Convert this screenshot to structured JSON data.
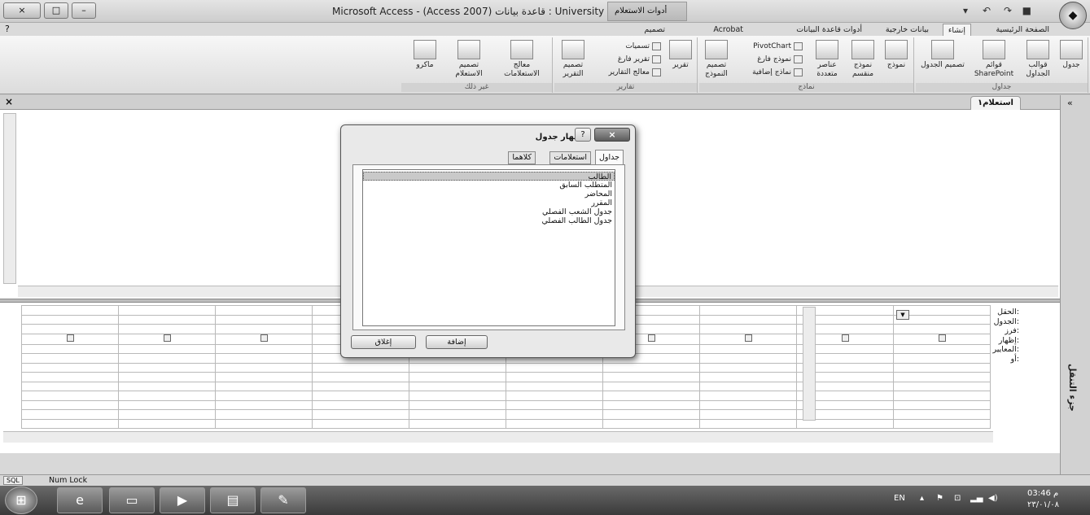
{
  "window": {
    "title": "Microsoft Access - (Access 2007) قاعدة بيانات : University",
    "contextual_tab": "أدوات الاستعلام",
    "controls": [
      "×",
      "□",
      "–"
    ]
  },
  "ribbon": {
    "tabs": [
      "الصفحة الرئيسية",
      "إنشاء",
      "بيانات خارجية",
      "أدوات قاعدة البيانات",
      "Acrobat",
      "تصميم"
    ],
    "active_tab": "إنشاء",
    "groups": {
      "tables": {
        "label": "جداول",
        "buttons": [
          "جدول",
          "قوالب الجداول",
          "قوائم SharePoint",
          "تصميم الجدول"
        ]
      },
      "forms": {
        "label": "نماذج",
        "buttons": [
          "نموذج",
          "نموذج منقسم",
          "عناصر متعددة",
          "تصميم النموذج"
        ],
        "small": [
          "PivotChart",
          "نموذج فارغ",
          "نماذج إضافية"
        ]
      },
      "reports": {
        "label": "تقارير",
        "buttons": [
          "تقرير",
          "تصميم التقرير"
        ],
        "small": [
          "تسميات",
          "تقرير فارغ",
          "معالج التقارير"
        ]
      },
      "other": {
        "label": "غير ذلك",
        "buttons": [
          "معالج الاستعلامات",
          "تصميم الاستعلام",
          "ماكرو"
        ]
      }
    }
  },
  "document": {
    "tab_label": "استعلام١",
    "close": "×"
  },
  "nav_pane": {
    "label": "جزء التنقل",
    "collapse": "«"
  },
  "grid": {
    "row_labels": [
      "الحقل:",
      "الجدول:",
      "فرز:",
      "إظهار:",
      "المعايير:",
      "أو:"
    ]
  },
  "dialog": {
    "title": "إظهار جدول",
    "help": "?",
    "close": "×",
    "tabs": [
      "جداول",
      "استعلامات",
      "كلاهما"
    ],
    "active_tab": "جداول",
    "items": [
      "الطالب",
      "المتطلب السابق",
      "المحاضر",
      "المقرر",
      "جدول الشعب الفصلي",
      "جدول الطالب الفصلي"
    ],
    "selected_item": "الطالب",
    "add_button": "إضافة",
    "close_button": "إغلاق"
  },
  "statusbar": {
    "sql_label": "SQL",
    "numlock": "Num Lock"
  },
  "taskbar": {
    "language": "EN",
    "time": "03:46 م",
    "date": "٢٣/٠١/٠٨"
  }
}
